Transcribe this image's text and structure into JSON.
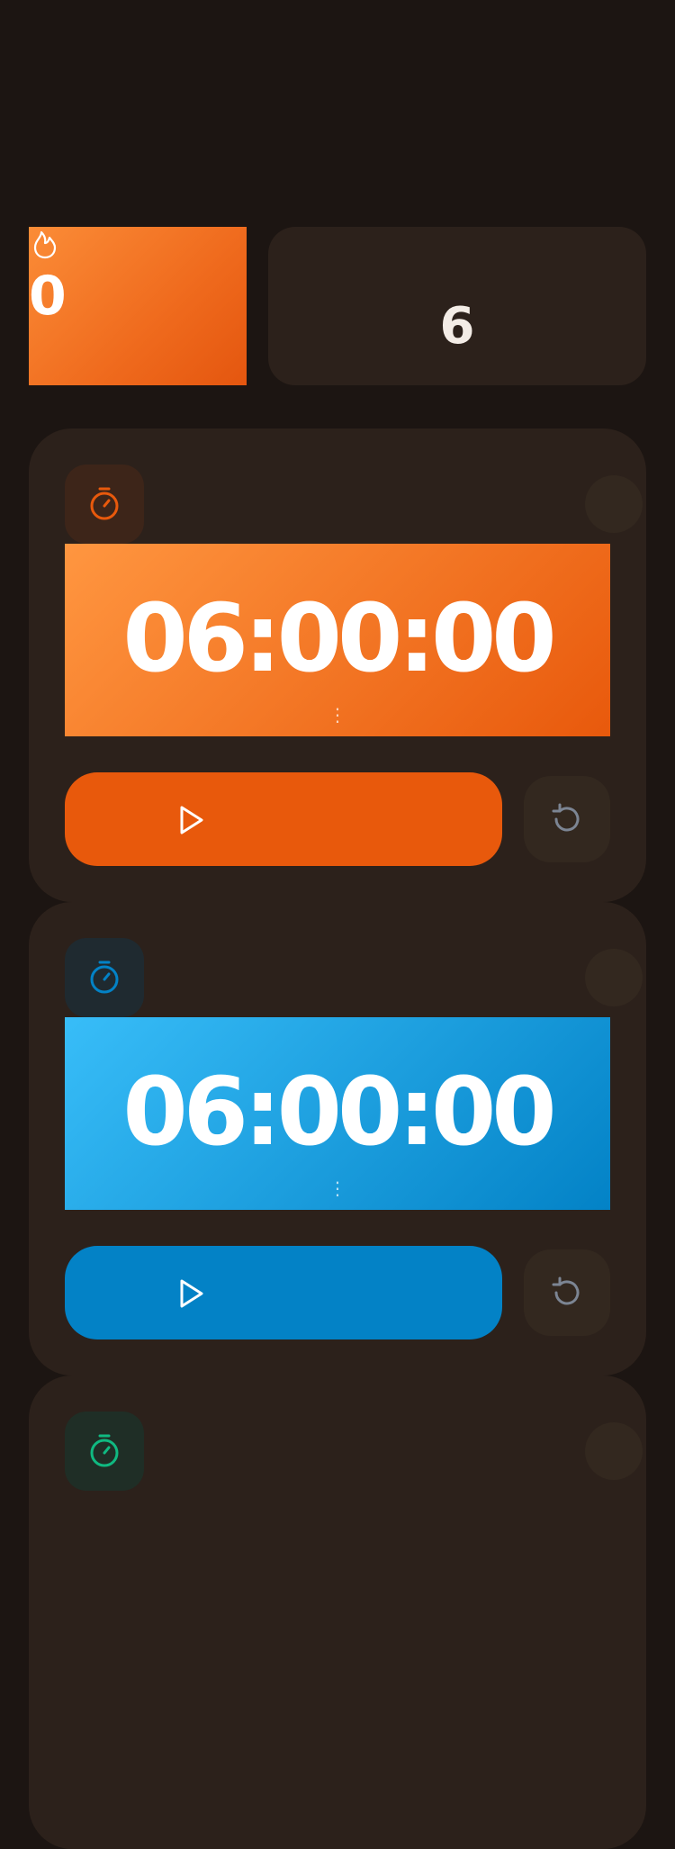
{
  "stats": {
    "streak": {
      "value": "0",
      "icon": "flame-icon"
    },
    "count": {
      "value": "6"
    }
  },
  "timers": [
    {
      "time": "06:00:00",
      "dots": "⋮",
      "accent": "#e8590c",
      "icon_bg": "#3d2519",
      "gradient": [
        "#ff9640",
        "#e8590c"
      ],
      "icon": "stopwatch-icon",
      "play_icon": "play-icon",
      "reset_icon": "reset-icon"
    },
    {
      "time": "06:00:00",
      "dots": "⋮",
      "accent": "#0382c6",
      "icon_bg": "#1f2a30",
      "gradient": [
        "#38bdf8",
        "#0382c6"
      ],
      "icon": "stopwatch-icon",
      "play_icon": "play-icon",
      "reset_icon": "reset-icon"
    },
    {
      "accent": "#10b981",
      "icon_bg": "#1f2e26",
      "icon": "stopwatch-icon"
    }
  ]
}
